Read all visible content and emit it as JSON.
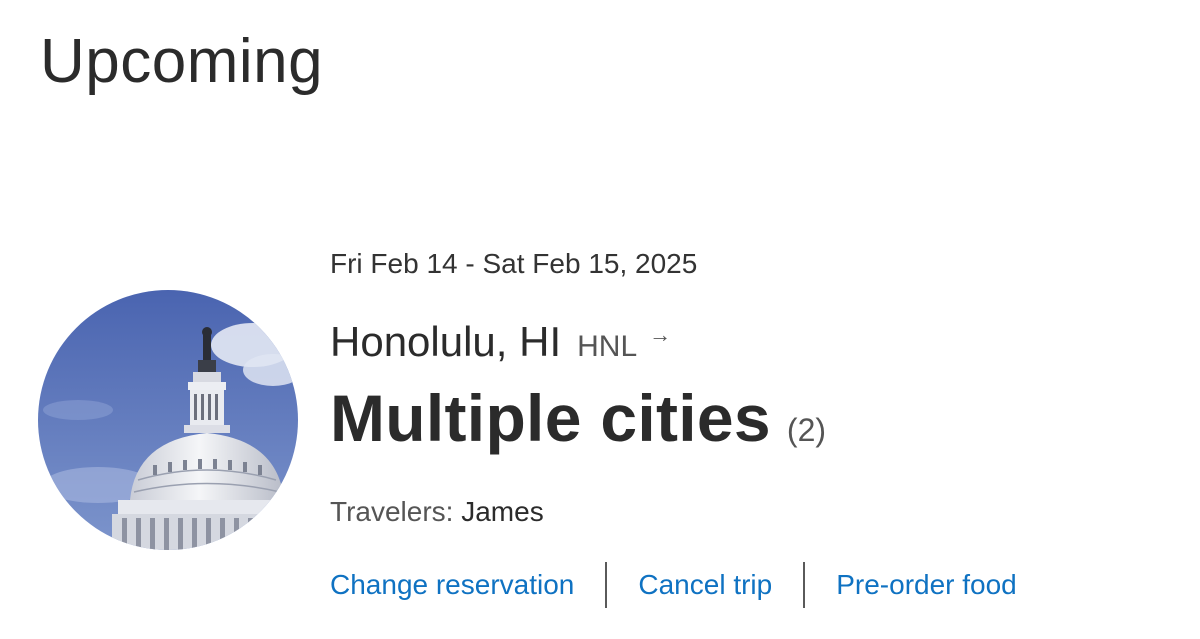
{
  "page": {
    "title": "Upcoming"
  },
  "trip": {
    "dates": "Fri Feb 14 - Sat Feb 15, 2025",
    "origin": {
      "city": "Honolulu, HI",
      "code": "HNL",
      "arrow_icon": "→"
    },
    "destination": {
      "city": "Multiple cities",
      "count": "(2)"
    },
    "travelers": {
      "label": "Travelers:",
      "value": "James"
    },
    "actions": {
      "change_reservation": "Change reservation",
      "cancel_trip": "Cancel trip",
      "preorder_food": "Pre-order food"
    },
    "photo_icon": "capitol-dome-photo"
  },
  "colors": {
    "link": "#0f72c2",
    "text": "#2b2b2b",
    "muted": "#555555",
    "sky": "#5a72b8"
  }
}
